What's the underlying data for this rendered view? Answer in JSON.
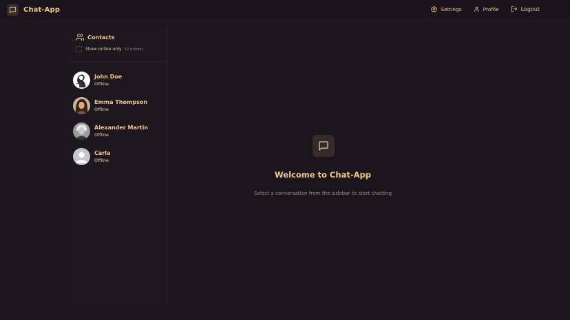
{
  "header": {
    "app_title": "Chat-App",
    "logo_icon": "message-square-icon",
    "nav": {
      "settings": "Settings",
      "profile": "Profile",
      "logout": "Logout"
    }
  },
  "sidebar": {
    "title": "Contacts",
    "filter_label": "Show online only",
    "online_count": "(0 online)",
    "contacts": [
      {
        "name": "John Doe",
        "status": "Offline"
      },
      {
        "name": "Emma Thompson",
        "status": "Offline"
      },
      {
        "name": "Alexander Martin",
        "status": "Offline"
      },
      {
        "name": "Carla",
        "status": "Offline"
      }
    ]
  },
  "main": {
    "welcome_title": "Welcome to Chat-App",
    "welcome_subtitle": "Select a conversation from the sidebar to start chatting"
  },
  "colors": {
    "background": "#1e161f",
    "accent": "#eac98a",
    "muted": "#9e8d84"
  }
}
